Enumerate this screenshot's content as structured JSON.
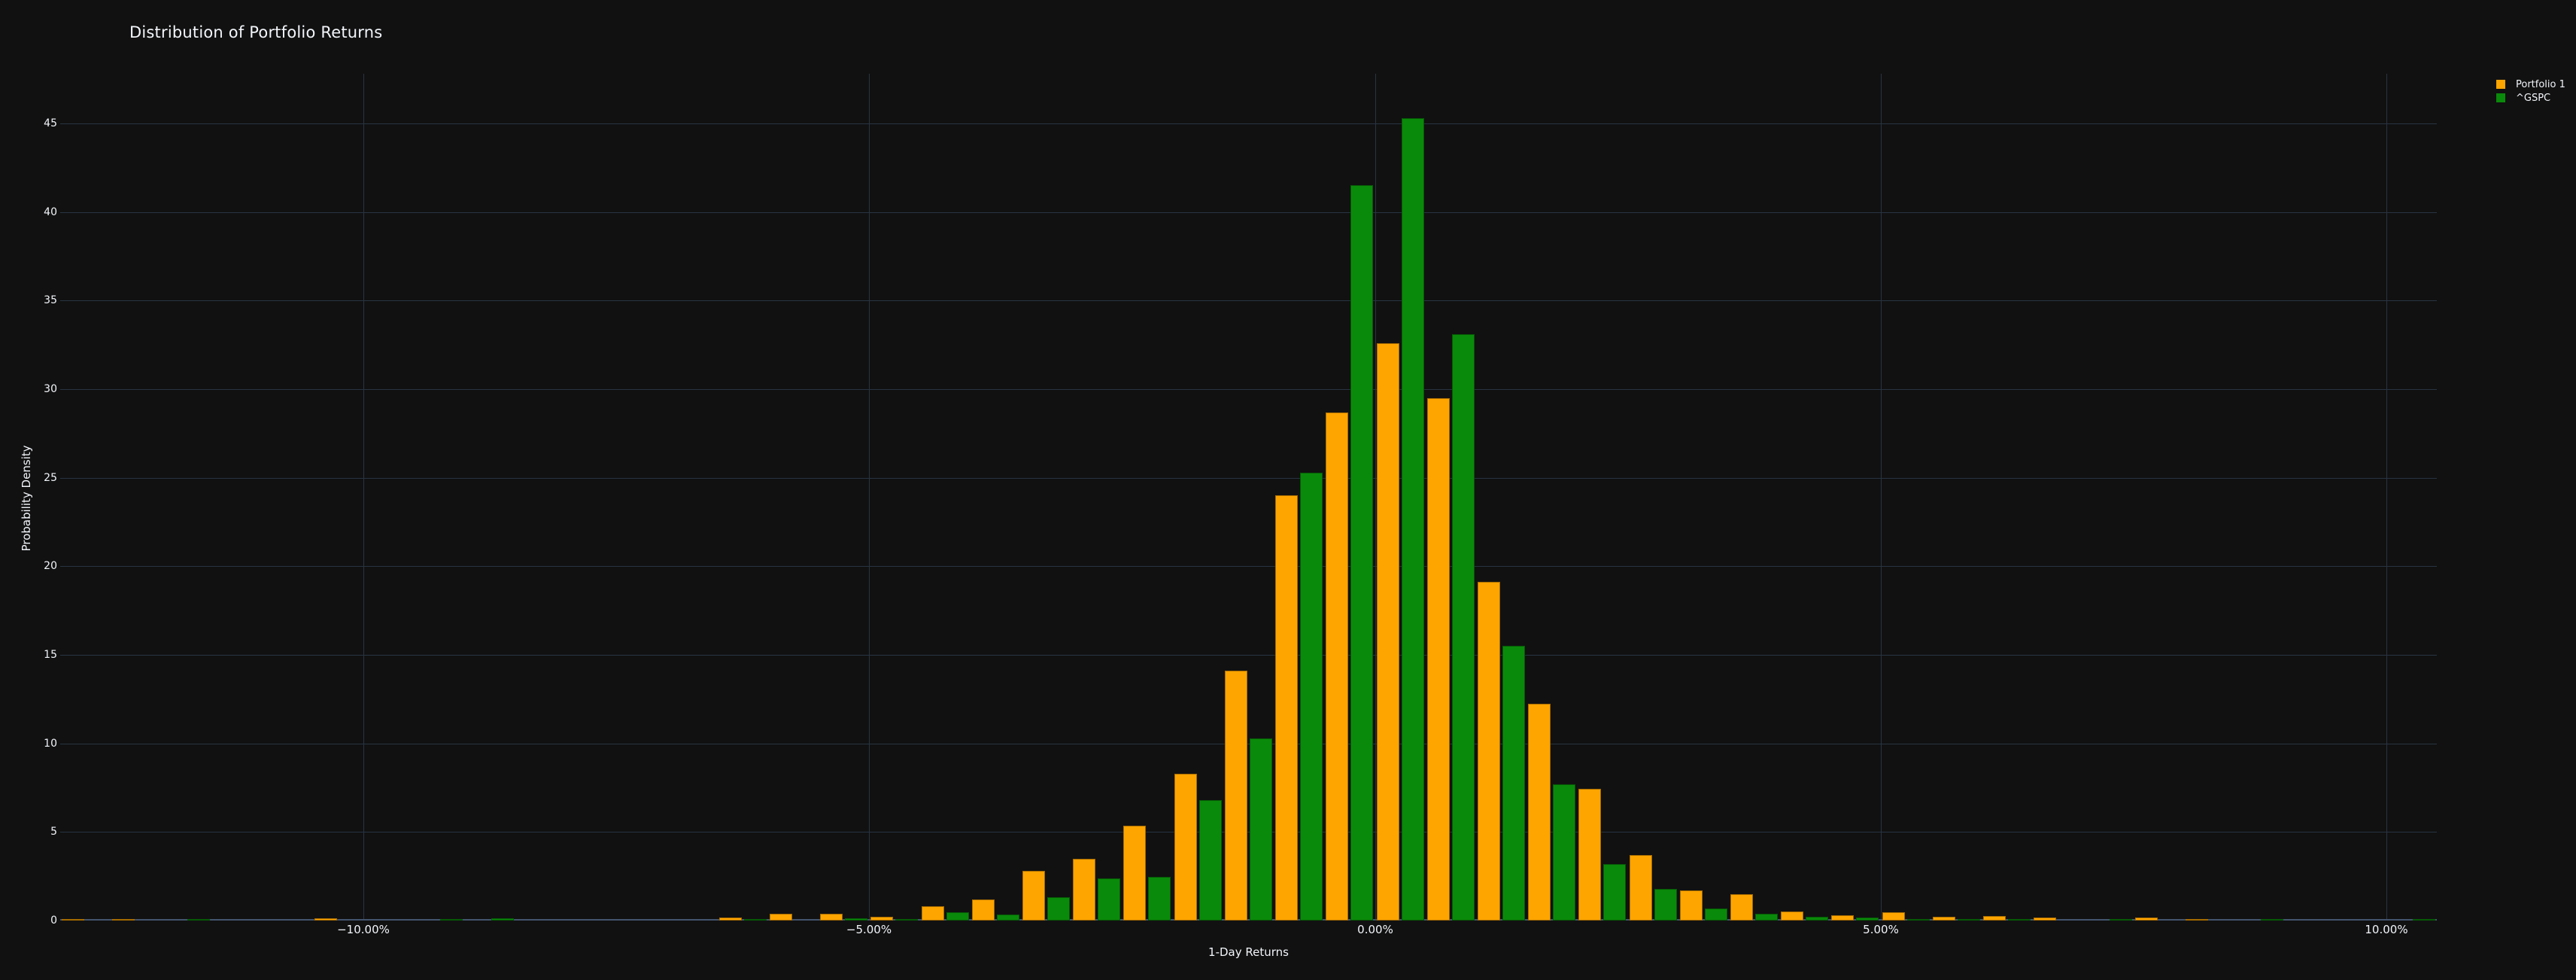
{
  "title": "Distribution of Portfolio Returns",
  "colors": {
    "background": "#111111",
    "grid": "#283442",
    "axis_line": "#42546e",
    "text": "#f2f5fa",
    "portfolio": "#ffa500",
    "gspc": "#0a8a0a"
  },
  "legend": {
    "items": [
      {
        "label": "Portfolio 1",
        "color": "#ffa500"
      },
      {
        "label": "^GSPC",
        "color": "#0a8a0a"
      }
    ]
  },
  "chart_data": {
    "type": "bar",
    "subtype": "histogram-grouped",
    "title": "Distribution of Portfolio Returns",
    "xlabel": "1-Day Returns",
    "ylabel": "Probability Density",
    "legend_position": "top-right",
    "grid": true,
    "xlim": [
      -13.0,
      10.5
    ],
    "ylim": [
      0,
      47.8
    ],
    "bin_width_pct": 0.5,
    "x_tick_values": [
      -10,
      -5,
      0,
      5,
      10
    ],
    "x_tick_labels": [
      "−10.00%",
      "−5.00%",
      "0.00%",
      "5.00%",
      "10.00%"
    ],
    "y_ticks": [
      0,
      5,
      10,
      15,
      20,
      25,
      30,
      35,
      40,
      45
    ],
    "y_tick_labels": [
      "0",
      "5",
      "10",
      "15",
      "20",
      "25",
      "30",
      "35",
      "40",
      "45"
    ],
    "bin_starts": [
      -13.0,
      -12.5,
      -12.0,
      -11.5,
      -11.0,
      -10.5,
      -10.0,
      -9.5,
      -9.0,
      -8.5,
      -8.0,
      -7.5,
      -7.0,
      -6.5,
      -6.0,
      -5.5,
      -5.0,
      -4.5,
      -4.0,
      -3.5,
      -3.0,
      -2.5,
      -2.0,
      -1.5,
      -1.0,
      -0.5,
      0.0,
      0.5,
      1.0,
      1.5,
      2.0,
      2.5,
      3.0,
      3.5,
      4.0,
      4.5,
      5.0,
      5.5,
      6.0,
      6.5,
      7.0,
      7.5,
      8.0,
      8.5,
      9.0,
      9.5,
      10.0
    ],
    "series": [
      {
        "name": "Portfolio 1",
        "color": "#ffa500",
        "values": [
          0.08,
          0.1,
          0,
          0,
          0,
          0.12,
          0,
          0,
          0,
          0,
          0,
          0,
          0,
          0.17,
          0.4,
          0.4,
          0.2,
          0.8,
          1.2,
          2.8,
          3.5,
          5.35,
          8.3,
          14.1,
          24.0,
          28.7,
          32.6,
          29.5,
          19.1,
          12.25,
          7.45,
          3.7,
          1.7,
          1.5,
          0.5,
          0.3,
          0.45,
          0.2,
          0.25,
          0.17,
          0,
          0.15,
          0.06,
          0,
          0,
          0,
          0
        ]
      },
      {
        "name": "^GSPC",
        "color": "#0a8a0a",
        "values": [
          0,
          0,
          0.1,
          0,
          0,
          0,
          0,
          0.08,
          0.12,
          0,
          0,
          0,
          0,
          0.07,
          0,
          0.12,
          0.1,
          0.45,
          0.35,
          1.3,
          2.4,
          2.45,
          6.8,
          10.3,
          25.3,
          41.5,
          45.3,
          33.1,
          15.5,
          7.7,
          3.2,
          1.8,
          0.7,
          0.4,
          0.2,
          0.15,
          0.08,
          0.06,
          0.03,
          0,
          0.06,
          0,
          0,
          0.08,
          0,
          0,
          0.05
        ]
      }
    ]
  }
}
